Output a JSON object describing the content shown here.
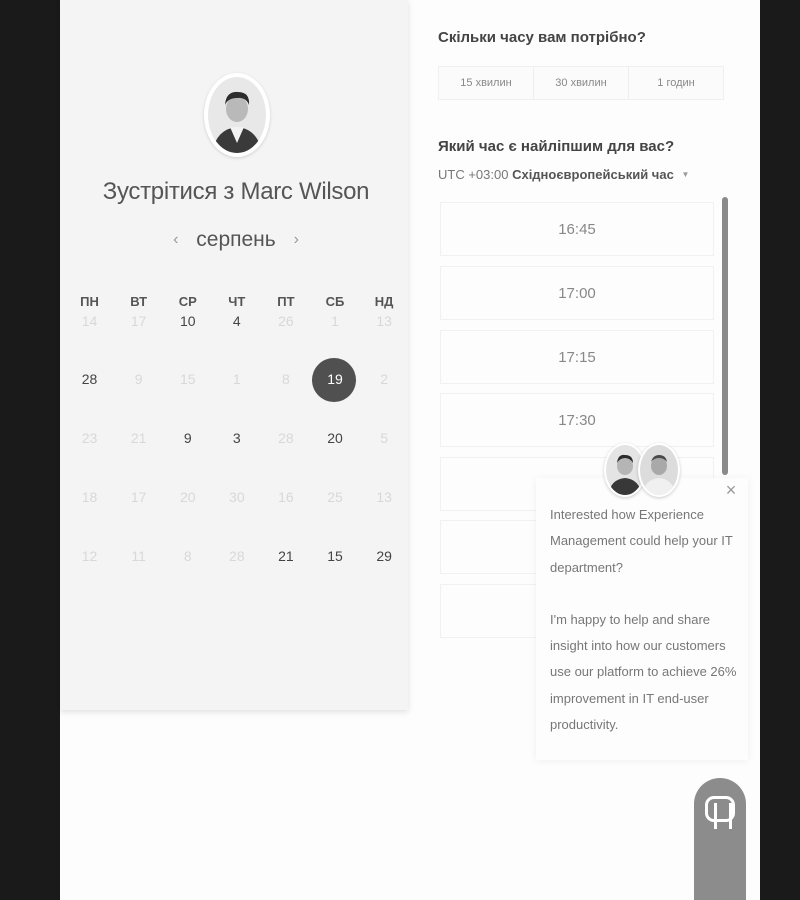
{
  "scheduler": {
    "title": "Зустрітися з Marc Wilson",
    "month": "серпень",
    "prev_icon": "‹",
    "next_icon": "›",
    "weekdays": [
      "ПН",
      "ВТ",
      "СР",
      "ЧТ",
      "ПТ",
      "СБ",
      "НД"
    ],
    "weeks": [
      [
        "14",
        "17",
        "10",
        "4",
        "26",
        "1",
        "13"
      ],
      [
        "28",
        "9",
        "15",
        "1",
        "8",
        "19",
        "2"
      ],
      [
        "23",
        "21",
        "9",
        "3",
        "28",
        "20",
        "5"
      ],
      [
        "18",
        "17",
        "20",
        "30",
        "16",
        "25",
        "13"
      ],
      [
        "12",
        "11",
        "8",
        "28",
        "21",
        "15",
        "29"
      ]
    ],
    "active_days": [
      [
        false,
        false,
        true,
        true,
        false,
        false,
        false
      ],
      [
        true,
        false,
        false,
        false,
        false,
        true,
        false
      ],
      [
        false,
        false,
        true,
        true,
        false,
        true,
        false
      ],
      [
        false,
        false,
        false,
        false,
        false,
        false,
        false
      ],
      [
        false,
        false,
        false,
        false,
        true,
        true,
        true
      ]
    ],
    "selected_day": "19"
  },
  "duration": {
    "question": "Скільки часу вам потрібно?",
    "options": [
      "15 хвилин",
      "30 хвилин",
      "1 годин"
    ]
  },
  "time": {
    "question": "Який час є найліпшим для вас?",
    "timezone_offset": "UTC +03:00",
    "timezone_name": "Східноєвропейський час",
    "slots": [
      "16:45",
      "17:00",
      "17:15",
      "17:30",
      "",
      "",
      ""
    ]
  },
  "chat": {
    "close_icon": "×",
    "message_1": "Interested how Experience Management could help your IT department?",
    "message_2": "I'm happy to help and share insight into how our customers use our platform to achieve 26% improvement in IT end-user productivity."
  },
  "colors": {
    "background": "#1a1a1a",
    "selected_day": "#505050",
    "launcher": "#8c8c8c"
  }
}
